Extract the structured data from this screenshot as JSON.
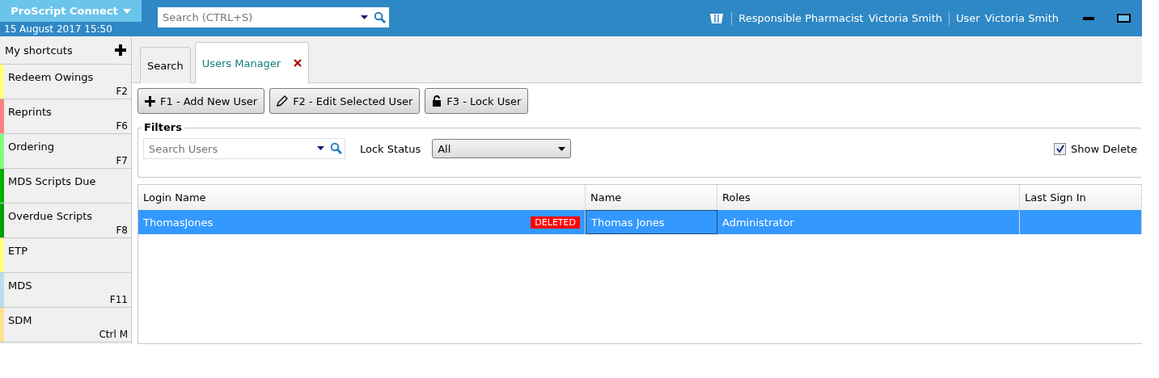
{
  "header": {
    "app_name": "ProScript Connect",
    "datetime": "15 August 2017 15:50",
    "search": {
      "placeholder": "Search (CTRL+S)"
    },
    "responsible_label": "Responsible Pharmacist",
    "responsible_name": "Victoria Smith",
    "user_label": "User",
    "user_name": "Victoria Smith"
  },
  "sidebar": {
    "title": "My shortcuts",
    "items": [
      {
        "label": "Redeem Owings",
        "shortcut": "F2",
        "color": "#ffff80"
      },
      {
        "label": "Reprints",
        "shortcut": "F6",
        "color": "#ff8080"
      },
      {
        "label": "Ordering",
        "shortcut": "F7",
        "color": "#80ff80"
      },
      {
        "label": "MDS Scripts Due",
        "color": "#00b000"
      },
      {
        "label": "Overdue Scripts",
        "shortcut": "F8",
        "color": "#00a000"
      },
      {
        "label": "ETP",
        "color": "#ffff80"
      },
      {
        "label": "MDS",
        "shortcut": "F11",
        "color": "#bcdcf0"
      },
      {
        "label": "SDM",
        "shortcut": "Ctrl M",
        "color": "#ffe090"
      }
    ]
  },
  "tabs": [
    {
      "label": "Search",
      "selected": false
    },
    {
      "label": "Users Manager",
      "selected": true
    }
  ],
  "toolbar": [
    {
      "label": "F1 - Add New User"
    },
    {
      "label": "F2 - Edit Selected User"
    },
    {
      "label": "F3 - Lock User"
    }
  ],
  "filters": {
    "title": "Filters",
    "search": {
      "placeholder": "Search Users"
    },
    "lock_status_label": "Lock Status",
    "lock_status_value": "All",
    "show_deleted": {
      "label": "Show Delete",
      "checked": true
    }
  },
  "table": {
    "columns": [
      "Login Name",
      "Name",
      "Roles",
      "Last Sign In"
    ],
    "rows": [
      {
        "login": "ThomasJones",
        "badge": "DELETED",
        "name": "Thomas Jones",
        "roles": "Administrator",
        "selected": true
      }
    ]
  }
}
